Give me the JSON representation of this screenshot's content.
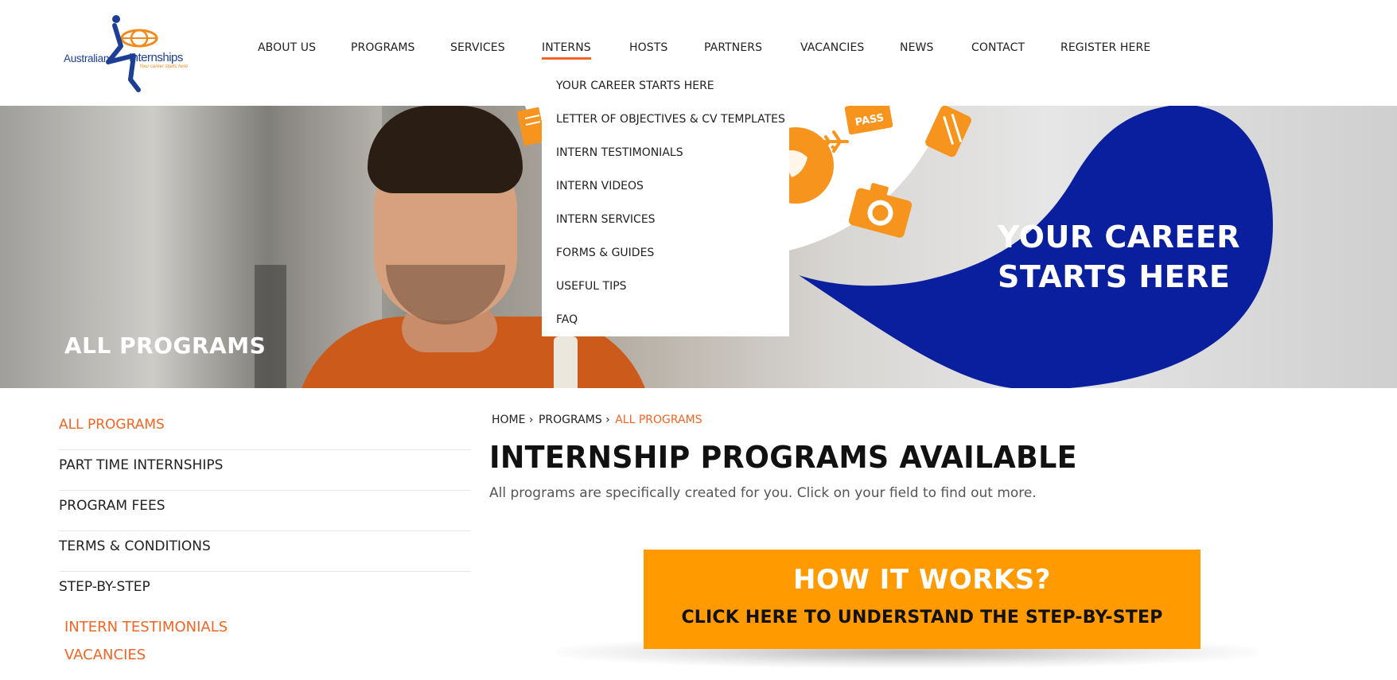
{
  "logo": {
    "line1": "Australian",
    "line2": "Internships",
    "tagline": "Your career starts here"
  },
  "nav": {
    "items": [
      {
        "label": "ABOUT US"
      },
      {
        "label": "PROGRAMS"
      },
      {
        "label": "SERVICES"
      },
      {
        "label": "INTERNS",
        "active": true
      },
      {
        "label": "HOSTS"
      },
      {
        "label": "PARTNERS"
      },
      {
        "label": "VACANCIES"
      },
      {
        "label": "NEWS"
      },
      {
        "label": "CONTACT"
      },
      {
        "label": "REGISTER HERE"
      }
    ]
  },
  "dropdown": {
    "items": [
      {
        "label": "YOUR CAREER STARTS HERE"
      },
      {
        "label": "LETTER OF OBJECTIVES & CV TEMPLATES"
      },
      {
        "label": "INTERN TESTIMONIALS"
      },
      {
        "label": "INTERN VIDEOS"
      },
      {
        "label": "INTERN SERVICES"
      },
      {
        "label": "FORMS & GUIDES"
      },
      {
        "label": "USEFUL TIPS"
      },
      {
        "label": "FAQ"
      }
    ]
  },
  "hero": {
    "title": "ALL PROGRAMS",
    "career_line1": "YOUR CAREER",
    "career_line2": "STARTS HERE",
    "pass_label": "PASS"
  },
  "sidebar": {
    "items": [
      {
        "label": "ALL PROGRAMS",
        "active": true
      },
      {
        "label": "PART TIME INTERNSHIPS"
      },
      {
        "label": "PROGRAM FEES"
      },
      {
        "label": "TERMS & CONDITIONS"
      },
      {
        "label": "STEP-BY-STEP"
      }
    ],
    "links": [
      {
        "label": "INTERN TESTIMONIALS"
      },
      {
        "label": "VACANCIES"
      }
    ]
  },
  "breadcrumb": {
    "home": "HOME ›",
    "programs": "PROGRAMS ›",
    "current": "ALL PROGRAMS"
  },
  "main": {
    "title": "INTERNSHIP PROGRAMS AVAILABLE",
    "subtitle": "All programs are specifically created for you. Click on your field to find out more."
  },
  "cta": {
    "line1": "HOW IT WORKS?",
    "line2": "CLICK HERE TO UNDERSTAND THE  STEP-BY-STEP"
  },
  "colors": {
    "accent_orange": "#f26522",
    "cta_orange": "#ff9a00",
    "brand_blue": "#0a1f9e"
  }
}
